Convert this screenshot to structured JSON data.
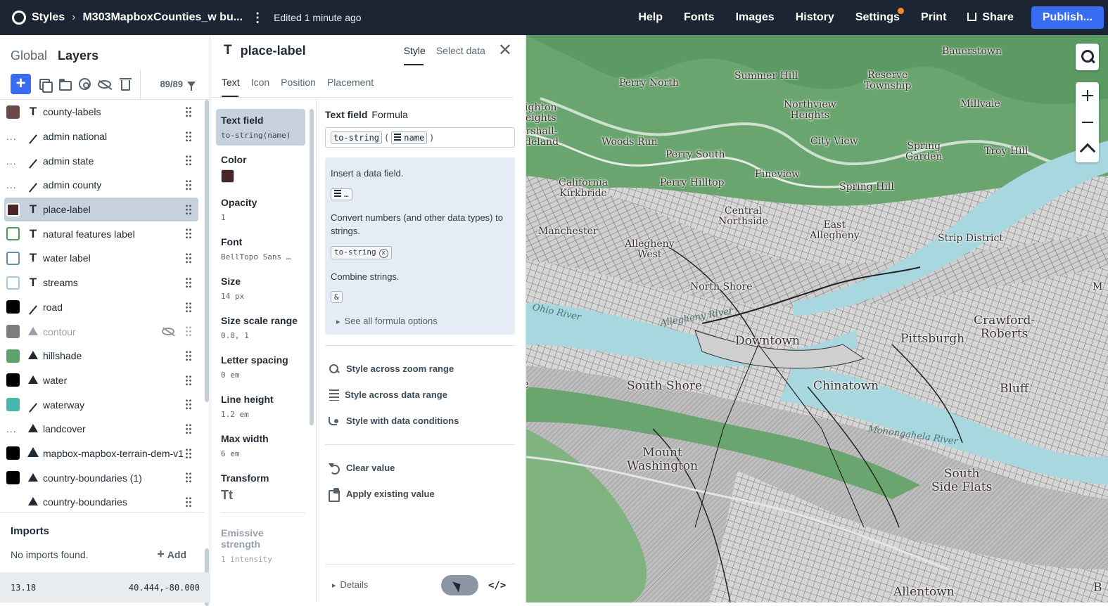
{
  "topbar": {
    "app": "Styles",
    "style_name": "M303MapboxCounties_w bu...",
    "edited": "Edited 1 minute ago",
    "nav": [
      "Help",
      "Fonts",
      "Images",
      "History",
      "Settings",
      "Print"
    ],
    "share": "Share",
    "publish": "Publish..."
  },
  "left": {
    "tabs": [
      "Global",
      "Layers"
    ],
    "active_tab": "Layers",
    "layer_count": "89/89",
    "layers": [
      {
        "name": "county-labels",
        "type": "symbol",
        "color": "#6b4a4a",
        "swatch": "fill"
      },
      {
        "name": "admin national",
        "type": "line",
        "swatch": "dots"
      },
      {
        "name": "admin state",
        "type": "line",
        "swatch": "dots"
      },
      {
        "name": "admin county",
        "type": "line",
        "swatch": "dots"
      },
      {
        "name": "place-label",
        "type": "symbol",
        "color": "#4a2627",
        "swatch": "fill",
        "selected": true
      },
      {
        "name": "natural features label",
        "type": "symbol",
        "color": "#4a9a5a",
        "swatch": "outline"
      },
      {
        "name": "water label",
        "type": "symbol",
        "color": "#6a8bb0",
        "swatch": "outline"
      },
      {
        "name": "streams",
        "type": "symbol",
        "color": "#a8c8e0",
        "swatch": "outline"
      },
      {
        "name": "road",
        "type": "line",
        "color": "#000000",
        "swatch": "fill"
      },
      {
        "name": "contour",
        "type": "fill",
        "color": "#7d7d7d",
        "swatch": "fill",
        "hidden": true
      },
      {
        "name": "hillshade",
        "type": "fill",
        "color": "#5aa36a",
        "swatch": "fill"
      },
      {
        "name": "water",
        "type": "fill",
        "color": "#000000",
        "swatch": "fill"
      },
      {
        "name": "waterway",
        "type": "line",
        "color": "#46b7ad",
        "swatch": "fill"
      },
      {
        "name": "landcover",
        "type": "fill",
        "swatch": "dots"
      },
      {
        "name": "mapbox-mapbox-terrain-dem-v1",
        "type": "outline",
        "color": "#000000",
        "swatch": "fill"
      },
      {
        "name": "country-boundaries (1)",
        "type": "fill",
        "color": "#000000",
        "swatch": "fill"
      },
      {
        "name": "country-boundaries",
        "type": "fill",
        "color": "#ffffff",
        "swatch": "outline"
      }
    ],
    "imports": {
      "title": "Imports",
      "empty": "No imports found.",
      "add": "Add"
    },
    "status": {
      "zoom": "13.18",
      "coords": "40.444,-80.000"
    }
  },
  "mid": {
    "title": "place-label",
    "tabs": [
      "Style",
      "Select data"
    ],
    "subtabs": [
      "Text",
      "Icon",
      "Position",
      "Placement"
    ],
    "props": [
      {
        "label": "Text field",
        "value": "to-string(name)",
        "selected": true
      },
      {
        "label": "Color",
        "color": "#4a2627"
      },
      {
        "label": "Opacity",
        "value": "1"
      },
      {
        "label": "Font",
        "value": "BellTopo Sans …"
      },
      {
        "label": "Size",
        "value": "14 px"
      },
      {
        "label": "Size scale range",
        "value": "0.8, 1"
      },
      {
        "label": "Letter spacing",
        "value": "0 em"
      },
      {
        "label": "Line height",
        "value": "1.2 em"
      },
      {
        "label": "Max width",
        "value": "6 em"
      },
      {
        "label": "Transform",
        "glyph": "Tt"
      },
      {
        "label": "Emissive strength",
        "value": "1 intensity"
      }
    ],
    "editor": {
      "label": "Text field",
      "mode": "Formula",
      "fn": "to-string",
      "open": "(",
      "field": "name",
      "close": ")",
      "help1": "Insert a data field.",
      "help2": "Convert numbers (and other data types) to strings.",
      "chip2": "to-string",
      "help3": "Combine strings.",
      "chip3": "&",
      "see_all": "See all formula options",
      "actions": [
        "Style across zoom range",
        "Style across data range",
        "Style with data conditions"
      ],
      "actions2": [
        "Clear value",
        "Apply existing value"
      ],
      "details": "Details",
      "code": "</>"
    }
  },
  "map": {
    "labels": [
      {
        "t": "Bauerstown"
      },
      {
        "t": "Perry North"
      },
      {
        "t": "Summer Hill"
      },
      {
        "t": "Reserve Township"
      },
      {
        "t": "Northview Heights"
      },
      {
        "t": "Millvale"
      },
      {
        "t": "ighton eights"
      },
      {
        "t": "rshall- deland"
      },
      {
        "t": "Woods Run"
      },
      {
        "t": "City View"
      },
      {
        "t": "Spring Garden"
      },
      {
        "t": "Troy Hill"
      },
      {
        "t": "Perry South"
      },
      {
        "t": "California Kirkbride"
      },
      {
        "t": "Perry Hilltop"
      },
      {
        "t": "Fineview"
      },
      {
        "t": "Spring Hill"
      },
      {
        "t": "Central Northside"
      },
      {
        "t": "Manchester"
      },
      {
        "t": "East Allegheny"
      },
      {
        "t": "Allegheny West"
      },
      {
        "t": "Strip District"
      },
      {
        "t": "North Shore"
      },
      {
        "t": "Ohio River"
      },
      {
        "t": "Allegheny River"
      },
      {
        "t": "Downtown"
      },
      {
        "t": "Pittsburgh"
      },
      {
        "t": "Crawford- Roberts"
      },
      {
        "t": "South Shore"
      },
      {
        "t": "Chinatown"
      },
      {
        "t": "Bluff"
      },
      {
        "t": "Monongahela River"
      },
      {
        "t": "Mount Washington"
      },
      {
        "t": "South Side Flats"
      },
      {
        "t": "Allentown"
      },
      {
        "t": "e"
      },
      {
        "t": "M"
      },
      {
        "t": "B"
      }
    ]
  }
}
